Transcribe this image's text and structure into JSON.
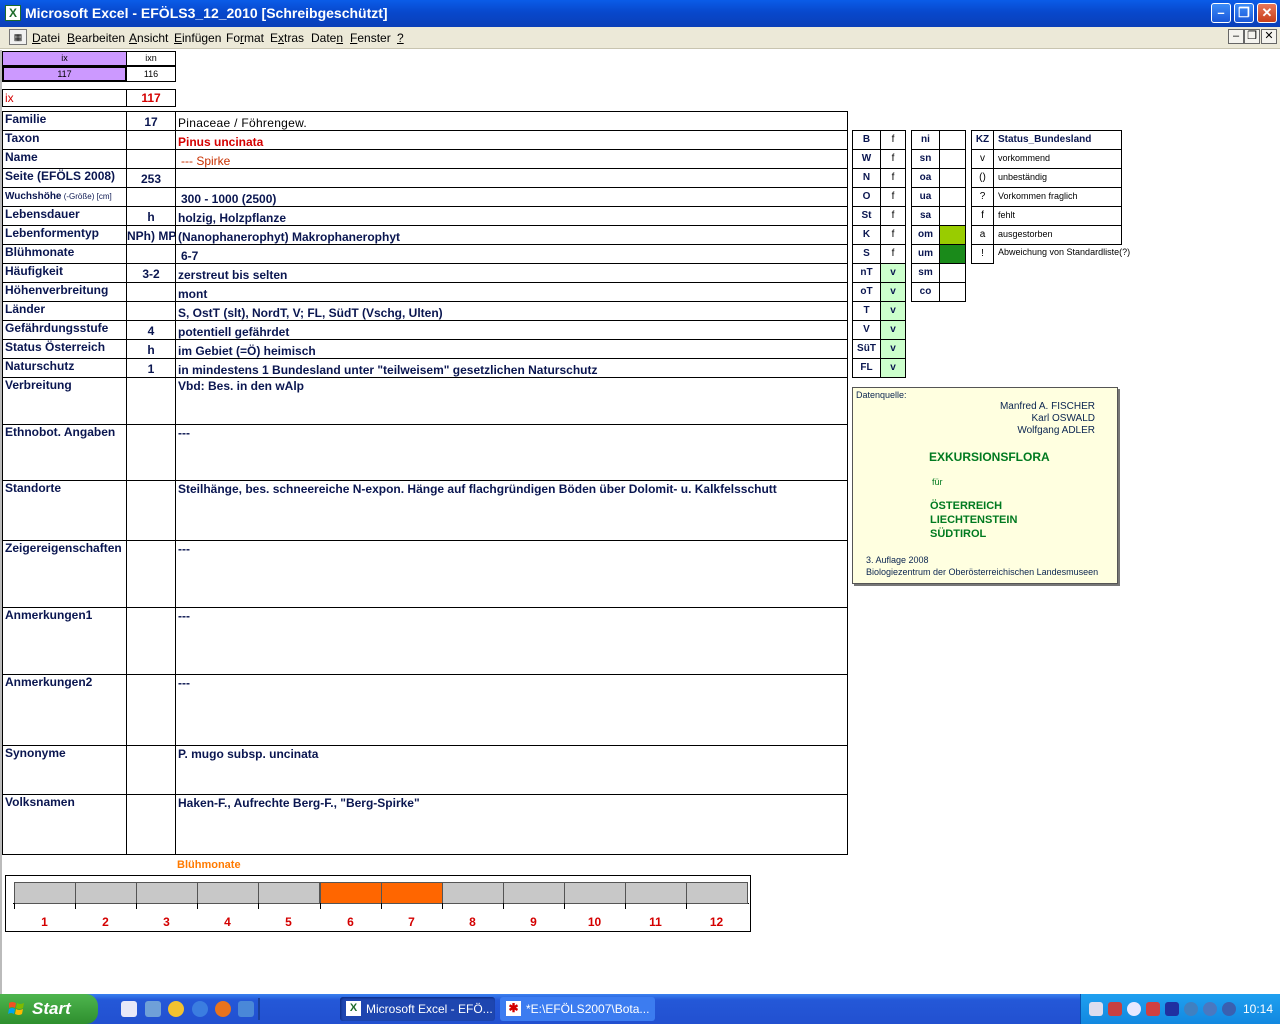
{
  "window": {
    "title": "Microsoft Excel - EFÖLS3_12_2010  [Schreibgeschützt]",
    "app_icon": "X"
  },
  "menu": {
    "items": [
      "Datei",
      "Bearbeiten",
      "Ansicht",
      "Einfügen",
      "Format",
      "Extras",
      "Daten",
      "Fenster",
      "?"
    ],
    "underline": [
      "D",
      "B",
      "A",
      "E",
      "r",
      "x",
      "n",
      "F",
      "?"
    ]
  },
  "index": {
    "hdr_ix": "ix",
    "hdr_ixn": "ixn",
    "val_ix": "117",
    "val_ixn": "116",
    "label": "ix",
    "value": "117"
  },
  "rows": [
    {
      "label": "Familie",
      "code": "17",
      "value": "Pinaceae  /  Föhrengew."
    },
    {
      "label": "Taxon",
      "code": "",
      "value": "Pinus uncinata"
    },
    {
      "label": "Name",
      "code": "",
      "value": "--- Spirke"
    },
    {
      "label": "Seite (EFÖLS 2008)",
      "code": "253",
      "value": ""
    },
    {
      "label_main": "Wuchshöhe",
      "label_sub": " (-Größe) [cm]",
      "code": "",
      "value": "300 - 1000 (2500)"
    },
    {
      "label": "Lebensdauer",
      "code": "h",
      "value": "holzig, Holzpflanze"
    },
    {
      "label": "Lebenformentyp",
      "code": "NPh) MPh",
      "value": "(Nanophanerophyt) Makrophanerophyt"
    },
    {
      "label": "Blühmonate",
      "code": "",
      "value": "6-7"
    },
    {
      "label": "Häufigkeit",
      "code": "3-2",
      "value": "zerstreut bis selten"
    },
    {
      "label": "Höhenverbreitung",
      "code": "",
      "value": "mont"
    },
    {
      "label": "Länder",
      "code": "",
      "value": "S, OstT (slt), NordT, V; FL, SüdT (Vschg, Ulten)"
    },
    {
      "label": "Gefährdungsstufe",
      "code": "4",
      "value": "potentiell gefährdet"
    },
    {
      "label": "Status Österreich",
      "code": "h",
      "value": "im Gebiet (=Ö) heimisch"
    },
    {
      "label": "Naturschutz",
      "code": "1",
      "value": "in mindestens 1 Bundesland unter \"teilweisem\" gesetzlichen Naturschutz"
    },
    {
      "label": "Verbreitung",
      "code": "",
      "value": "Vbd: Bes. in den wAlp"
    },
    {
      "label": "Ethnobot. Angaben",
      "code": "",
      "value": "---"
    },
    {
      "label": "Standorte",
      "code": "",
      "value": "Steilhänge, bes. schneereiche N-expon. Hänge auf flachgründigen Böden über Dolomit- u. Kalkfelsschutt"
    },
    {
      "label": "Zeigereigenschaften",
      "code": "",
      "value": "---"
    },
    {
      "label": "Anmerkungen1",
      "code": "",
      "value": "---"
    },
    {
      "label": "Anmerkungen2",
      "code": "",
      "value": "---"
    },
    {
      "label": "Synonyme",
      "code": "",
      "value": "P. mugo subsp. uncinata"
    },
    {
      "label": "Volksnamen",
      "code": "",
      "value": "Haken-F., Aufrechte Berg-F., \"Berg-Spirke\""
    }
  ],
  "states": [
    {
      "code": "B",
      "status": "f"
    },
    {
      "code": "W",
      "status": "f"
    },
    {
      "code": "N",
      "status": "f"
    },
    {
      "code": "O",
      "status": "f"
    },
    {
      "code": "St",
      "status": "f"
    },
    {
      "code": "K",
      "status": "f"
    },
    {
      "code": "S",
      "status": "f"
    },
    {
      "code": "nT",
      "status": "v"
    },
    {
      "code": "oT",
      "status": "v"
    },
    {
      "code": "T",
      "status": "v"
    },
    {
      "code": "V",
      "status": "v"
    },
    {
      "code": "SüT",
      "status": "v"
    },
    {
      "code": "FL",
      "status": "v"
    }
  ],
  "zones": [
    {
      "code": "ni",
      "color": ""
    },
    {
      "code": "sn",
      "color": ""
    },
    {
      "code": "oa",
      "color": ""
    },
    {
      "code": "ua",
      "color": ""
    },
    {
      "code": "sa",
      "color": ""
    },
    {
      "code": "om",
      "color": "#99cc00"
    },
    {
      "code": "um",
      "color": "#1a8a1a"
    },
    {
      "code": "sm",
      "color": ""
    },
    {
      "code": "co",
      "color": ""
    }
  ],
  "legend": {
    "hdr_kz": "KZ",
    "hdr_status": "Status_Bundesland",
    "items": [
      {
        "kz": "v",
        "text": "vorkommend"
      },
      {
        "kz": "()",
        "text": "unbeständig"
      },
      {
        "kz": "?",
        "text": "Vorkommen fraglich"
      },
      {
        "kz": "f",
        "text": "fehlt"
      },
      {
        "kz": "a",
        "text": "ausgestorben"
      },
      {
        "kz": "!",
        "text": "Abweichung von Standardliste(?)"
      }
    ]
  },
  "source": {
    "label": "Datenquelle:",
    "authors": [
      "Manfred A. FISCHER",
      "Karl OSWALD",
      "Wolfgang ADLER"
    ],
    "title": "EXKURSIONSFLORA",
    "fuer": "für",
    "regions": [
      "ÖSTERREICH",
      "LIECHTENSTEIN",
      "SÜDTIROL"
    ],
    "edition": "3. Auflage 2008",
    "publisher": "Biologiezentrum der Oberösterreichischen Landesmuseen"
  },
  "bloom": {
    "title": "Blühmonate",
    "months": [
      "1",
      "2",
      "3",
      "4",
      "5",
      "6",
      "7",
      "8",
      "9",
      "10",
      "11",
      "12"
    ],
    "active": [
      false,
      false,
      false,
      false,
      false,
      true,
      true,
      false,
      false,
      false,
      false,
      false
    ],
    "on_color": "#ff6600",
    "off_color": "#c8c8c8"
  },
  "taskbar": {
    "start": "Start",
    "tasks": [
      "Microsoft Excel - EFÖ...",
      "*E:\\EFÖLS2007\\Bota..."
    ],
    "clock": "10:14"
  }
}
